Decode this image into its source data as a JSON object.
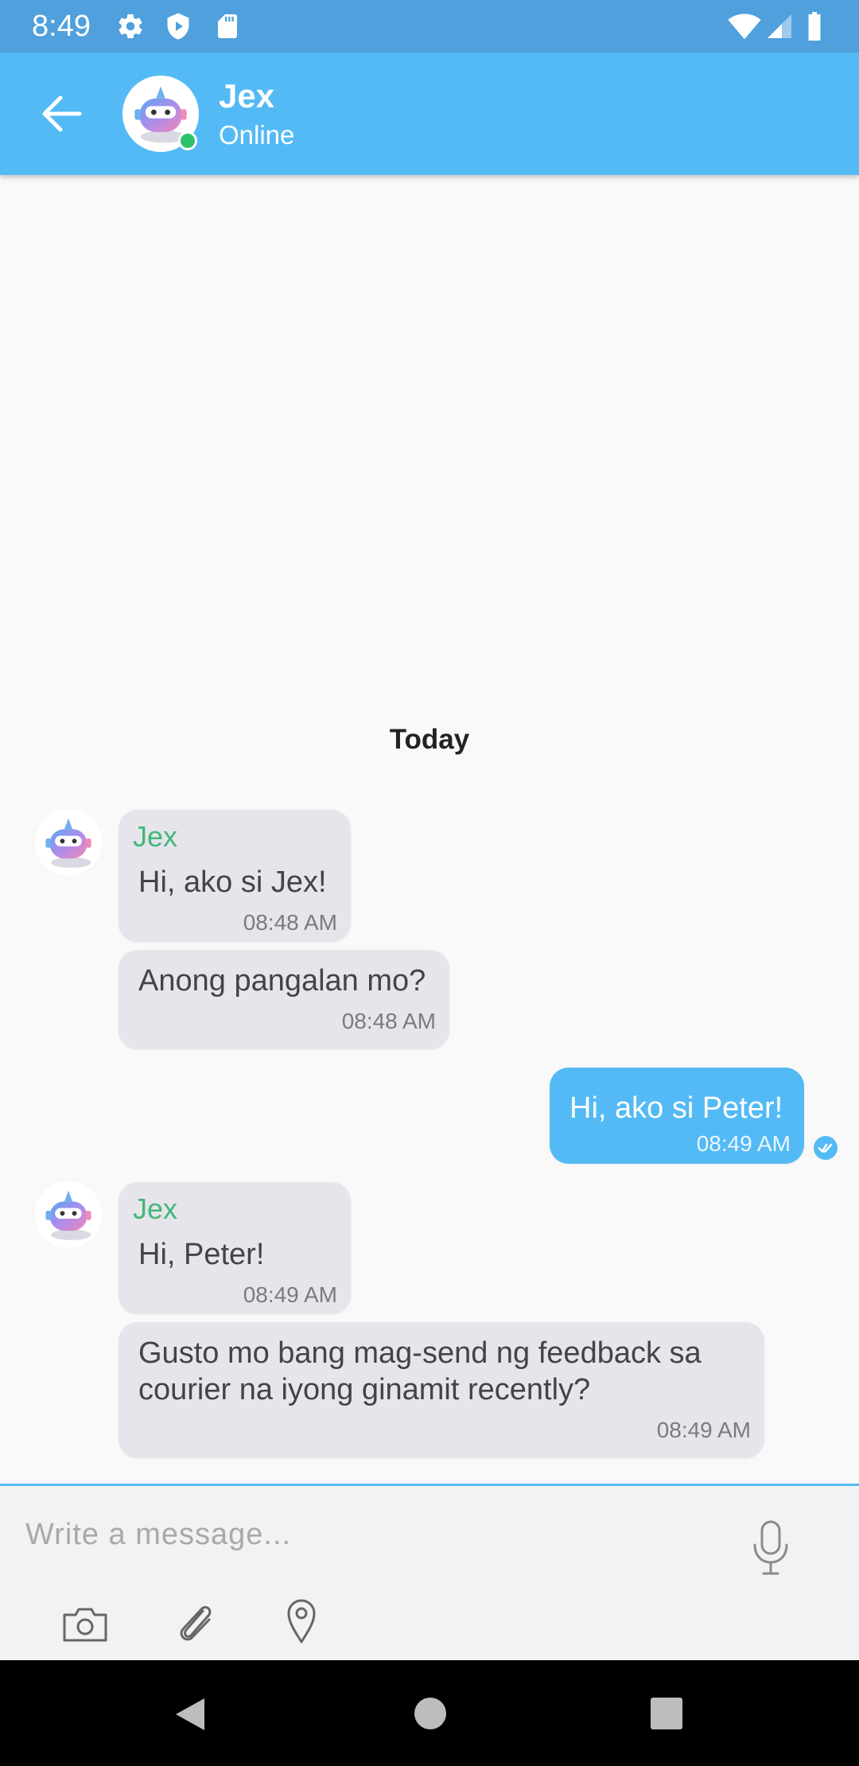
{
  "status_bar": {
    "time": "8:49",
    "icons": [
      "settings-icon",
      "shield-play-icon",
      "sd-card-icon",
      "wifi-icon",
      "signal-icon",
      "battery-icon"
    ]
  },
  "header": {
    "back_icon": "arrow-left-icon",
    "contact_name": "Jex",
    "contact_status": "Online"
  },
  "conversation": {
    "date_divider": "Today",
    "messages": [
      {
        "direction": "incoming",
        "sender": "Jex",
        "text": "Hi, ako si Jex!",
        "time": "08:48 AM"
      },
      {
        "direction": "incoming",
        "text": "Anong pangalan mo?",
        "time": "08:48 AM"
      },
      {
        "direction": "outgoing",
        "text": "Hi, ako si Peter!",
        "time": "08:49 AM",
        "status": "read"
      },
      {
        "direction": "incoming",
        "sender": "Jex",
        "text": "Hi, Peter!",
        "time": "08:49 AM"
      },
      {
        "direction": "incoming",
        "text": "Gusto mo bang mag-send ng feedback sa\ncourier na iyong ginamit recently?",
        "time": "08:49 AM"
      }
    ]
  },
  "composer": {
    "placeholder": "Write a message...",
    "value": "",
    "actions": [
      "camera-icon",
      "paperclip-icon",
      "location-pin-icon",
      "microphone-icon"
    ]
  },
  "colors": {
    "status_bar": "#4fa0dc",
    "app_bar": "#53baf5",
    "outgoing_bubble": "#53baf5",
    "incoming_bubble": "#e6e5eb",
    "sender_name": "#44b779",
    "online_dot": "#2ec26c"
  }
}
